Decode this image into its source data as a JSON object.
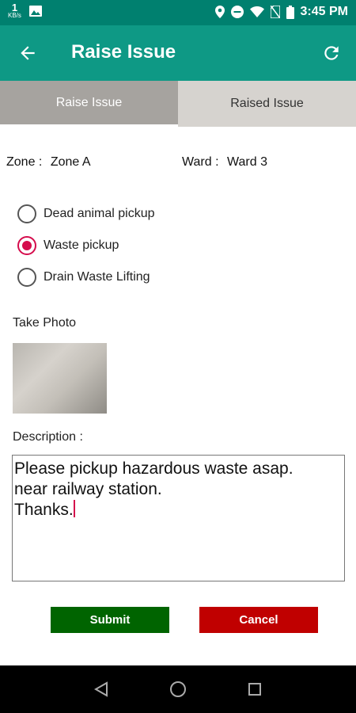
{
  "status_bar": {
    "speed_value": "1",
    "speed_unit": "KB/s",
    "time": "3:45 PM"
  },
  "app_bar": {
    "title": "Raise Issue"
  },
  "tabs": [
    {
      "label": "Raise Issue",
      "active": true
    },
    {
      "label": "Raised Issue",
      "active": false
    }
  ],
  "location": {
    "zone_label": "Zone :",
    "zone_value": "Zone A",
    "ward_label": "Ward :",
    "ward_value": "Ward 3"
  },
  "issue_types": [
    {
      "label": "Dead animal pickup",
      "checked": false
    },
    {
      "label": "Waste pickup",
      "checked": true
    },
    {
      "label": "Drain Waste Lifting",
      "checked": false
    }
  ],
  "photo": {
    "label": "Take Photo"
  },
  "description": {
    "label": "Description :",
    "value": "Please pickup hazardous waste asap.\nnear railway station.\nThanks."
  },
  "buttons": {
    "submit": "Submit",
    "cancel": "Cancel"
  },
  "colors": {
    "primary": "#0e9985",
    "status_bar": "#00806f",
    "accent": "#d50c4c",
    "submit": "#006400",
    "cancel": "#c00000"
  }
}
